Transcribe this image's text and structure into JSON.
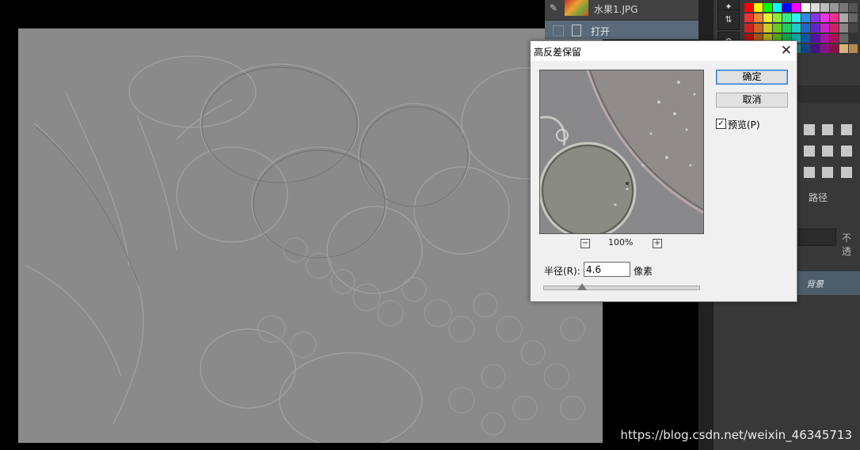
{
  "history": {
    "item1_label": "水果1.JPG",
    "item2_label": "打开"
  },
  "dialog": {
    "title": "高反差保留",
    "ok_label": "确定",
    "cancel_label": "取消",
    "preview_label": "预览(P)",
    "preview_checked": true,
    "zoom_level": "100%",
    "zoom_out_symbol": "−",
    "zoom_in_symbol": "+",
    "radius_label": "半径(R):",
    "radius_value": "4.6",
    "unit_label": "像素",
    "slider_value_fraction": 0.25
  },
  "right_panel": {
    "paths_tab": "路径",
    "opacity_label": "不透",
    "layer_name": "背景"
  },
  "watermark": "https://blog.csdn.net/weixin_46345713",
  "colors": {
    "canvas_gray": "#8a8a8a",
    "panel_dark": "#383838",
    "selected_row": "#5a6a7a",
    "ok_border": "#2f7ad6"
  }
}
